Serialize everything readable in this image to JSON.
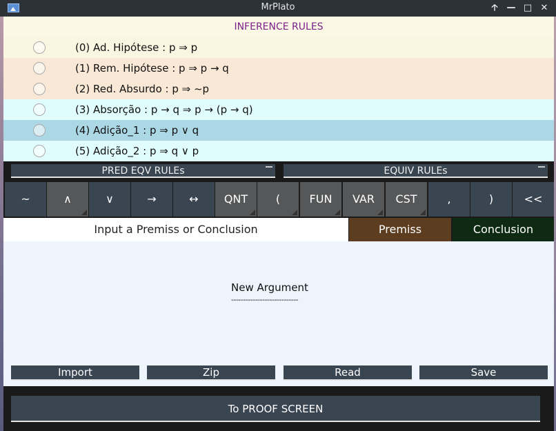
{
  "window": {
    "title": "MrPlato",
    "controls": {
      "maximize_up": "🡡",
      "minimize": "—",
      "maximize": "□",
      "close": "✕"
    }
  },
  "inference": {
    "header": "INFERENCE RULES",
    "rules": [
      {
        "label": "(0) Ad. Hipótese : p ⇒ p",
        "bg": "#fbf6e1"
      },
      {
        "label": "(1) Rem. Hipótese : p ⇒ p → q",
        "bg": "#f9e8d6"
      },
      {
        "label": "(2) Red. Absurdo : p ⇒ ~p",
        "bg": "#f9e8d6"
      },
      {
        "label": "(3) Absorção : p → q ⇒ p → (p → q)",
        "bg": "#e1fcfd"
      },
      {
        "label": "(4) Adição_1 : p ⇒ p ∨ q",
        "bg": "#acd7e5"
      },
      {
        "label": "(5) Adição_2 : p ⇒ q ∨ p",
        "bg": "#e1fcfd"
      }
    ]
  },
  "dropdowns": {
    "pred_eqv": "PRED EQV RULEs",
    "equiv": "EQUIV RULEs"
  },
  "keypad": [
    {
      "label": "~",
      "style": "blue"
    },
    {
      "label": "∧",
      "style": "gray"
    },
    {
      "label": "∨",
      "style": "blue"
    },
    {
      "label": "→",
      "style": "blue"
    },
    {
      "label": "↔",
      "style": "blue"
    },
    {
      "label": "QNT",
      "style": "gray"
    },
    {
      "label": "(",
      "style": "gray"
    },
    {
      "label": "FUN",
      "style": "gray"
    },
    {
      "label": "VAR",
      "style": "gray"
    },
    {
      "label": "CST",
      "style": "gray"
    },
    {
      "label": ",",
      "style": "blue"
    },
    {
      "label": ")",
      "style": "blue"
    },
    {
      "label": "<<",
      "style": "blue"
    }
  ],
  "input": {
    "prompt": "Input a Premiss or Conclusion",
    "premiss": "Premiss",
    "conclusion": "Conclusion"
  },
  "argument": {
    "title": "New Argument",
    "underline": "----------------------------"
  },
  "file_buttons": {
    "import": "Import",
    "zip": "Zip",
    "read": "Read",
    "save": "Save"
  },
  "proof_button": "To PROOF SCREEN",
  "colors": {
    "title_bar": "#2d3239",
    "header_text": "#7e1f8c",
    "button_blue": "#3a4552",
    "key_gray": "#565758",
    "premiss_bg": "#5c3d1f",
    "conclusion_bg": "#0e2a12",
    "argument_bg": "#eef4fc"
  }
}
